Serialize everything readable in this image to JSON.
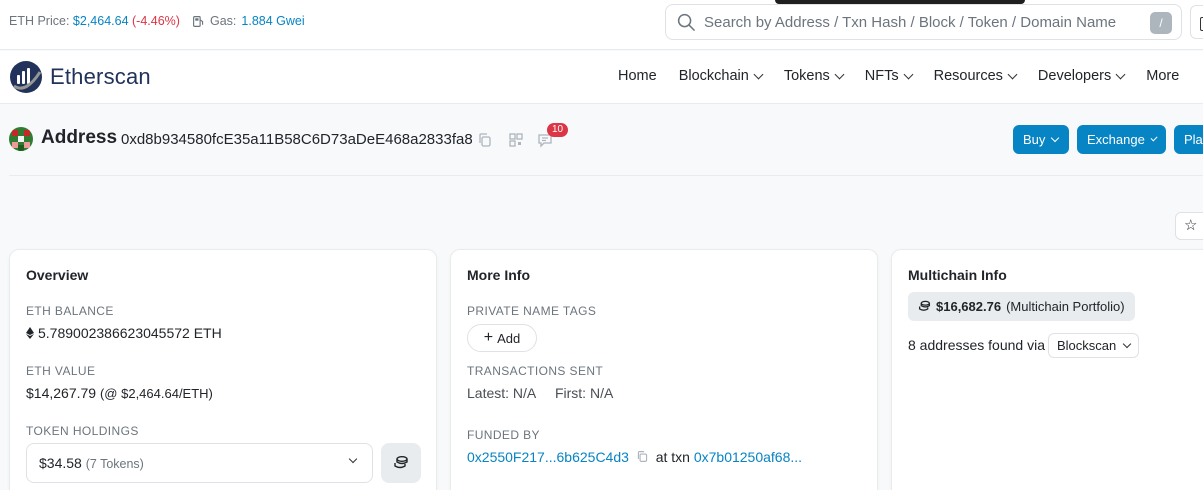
{
  "topbar": {
    "eth_price_label": "ETH Price:",
    "eth_price_value": "$2,464.64",
    "eth_price_change": "(-4.46%)",
    "gas_label": "Gas:",
    "gas_value": "1.884 Gwei",
    "search_placeholder": "Search by Address / Txn Hash / Block / Token / Domain Name",
    "search_shortcut": "/"
  },
  "nav": {
    "logo_text": "Etherscan",
    "items": [
      {
        "label": "Home",
        "dropdown": false
      },
      {
        "label": "Blockchain",
        "dropdown": true
      },
      {
        "label": "Tokens",
        "dropdown": true
      },
      {
        "label": "NFTs",
        "dropdown": true
      },
      {
        "label": "Resources",
        "dropdown": true
      },
      {
        "label": "Developers",
        "dropdown": true
      },
      {
        "label": "More",
        "dropdown": false
      }
    ]
  },
  "address": {
    "title": "Address",
    "hash": "0xd8b934580fcE35a11B58C6D73aDeE468a2833fa8",
    "comment_count": "10",
    "buttons": {
      "buy": "Buy",
      "exchange": "Exchange",
      "play": "Play"
    }
  },
  "overview": {
    "title": "Overview",
    "eth_balance_label": "ETH BALANCE",
    "eth_balance_value": "5.789002386623045572 ETH",
    "eth_value_label": "ETH VALUE",
    "eth_value_amount": "$14,267.79",
    "eth_value_rate": "(@ $2,464.64/ETH)",
    "token_holdings_label": "TOKEN HOLDINGS",
    "token_holdings_value": "$34.58",
    "token_holdings_count": "(7 Tokens)"
  },
  "more_info": {
    "title": "More Info",
    "private_tags_label": "PRIVATE NAME TAGS",
    "add_label": "Add",
    "tx_sent_label": "TRANSACTIONS SENT",
    "latest_label": "Latest:",
    "latest_value": "N/A",
    "first_label": "First:",
    "first_value": "N/A",
    "funded_by_label": "FUNDED BY",
    "funded_by_address": "0x2550F217...6b625C4d3",
    "at_txn_label": "at txn",
    "funded_txn": "0x7b01250af68..."
  },
  "multichain": {
    "title": "Multichain Info",
    "portfolio_value": "$16,682.76",
    "portfolio_label": "(Multichain Portfolio)",
    "addresses_text": "8 addresses found via",
    "via_option": "Blockscan"
  },
  "colors": {
    "accent": "#0784c3",
    "negative": "#dc3545",
    "logo": "#21325b"
  }
}
